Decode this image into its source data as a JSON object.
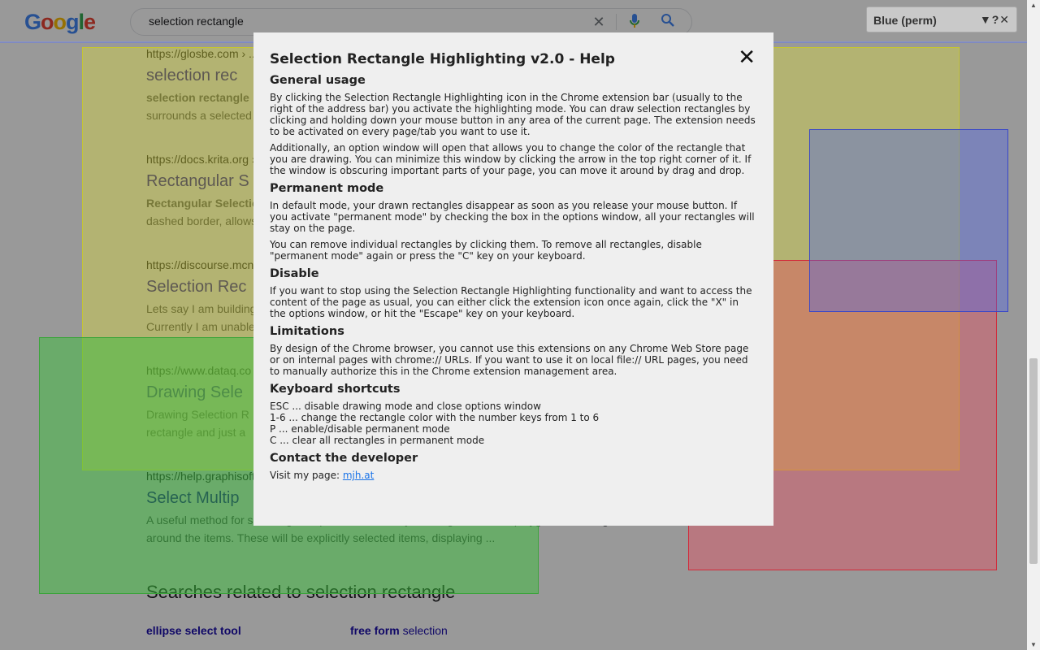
{
  "search": {
    "query": "selection rectangle",
    "logo_letters": [
      "G",
      "o",
      "o",
      "g",
      "l",
      "e"
    ]
  },
  "results": [
    {
      "cite": "https://glosbe.com › ...",
      "title": "selection rec",
      "snippet_bold": "selection rectangle",
      "snippet": "surrounds a selected"
    },
    {
      "cite": "https://docs.krita.org ›",
      "title": "Rectangular S",
      "snippet_bold": "Rectangular Selectio",
      "snippet": "dashed border, allows"
    },
    {
      "cite": "https://discourse.mcn",
      "title": "Selection Rec",
      "snippet_line1": "Lets say I am building",
      "snippet_line2": "Currently I am unable"
    },
    {
      "cite": "https://www.dataq.co",
      "title": "Drawing Sele",
      "snippet_line1": "Drawing Selection R",
      "snippet_line2": "rectangle and just a"
    },
    {
      "cite": "https://help.graphisoft",
      "title": "Select Multip",
      "snippet_line1": "A useful method for selecting multiple elements is by drawing a selection polygon or rectangle",
      "snippet_line2": "around the items. These will be explicitly selected items, displaying ..."
    }
  ],
  "related": {
    "heading": "Searches related to selection rectangle",
    "items": [
      {
        "bold": "ellipse select tool",
        "normal": ""
      },
      {
        "bold": "free form",
        "normal": " selection"
      }
    ]
  },
  "options_window": {
    "label": "Blue (perm)",
    "minimize": "▼",
    "help": "?",
    "close": "✕"
  },
  "help": {
    "title": "Selection Rectangle Highlighting v2.0 - Help",
    "close": "✕",
    "sections": {
      "general": {
        "heading": "General usage",
        "p1": "By clicking the Selection Rectangle Highlighting icon in the Chrome extension bar (usually to the right of the address bar) you activate the highlighting mode. You can draw selection rectangles by clicking and holding down your mouse button in any area of the current page. The extension needs to be activated on every page/tab you want to use it.",
        "p2": "Additionally, an option window will open that allows you to change the color of the rectangle that you are drawing. You can minimize this window by clicking the arrow in the top right corner of it. If the window is obscuring important parts of your page, you can move it around by drag and drop."
      },
      "permanent": {
        "heading": "Permanent mode",
        "p1": "In default mode, your drawn rectangles disappear as soon as you release your mouse button. If you activate \"permanent mode\" by checking the box in the options window, all your rectangles will stay on the page.",
        "p2": "You can remove individual rectangles by clicking them. To remove all rectangles, disable \"permanent mode\" again or press the \"C\" key on your keyboard."
      },
      "disable": {
        "heading": "Disable",
        "p1": "If you want to stop using the Selection Rectangle Highlighting functionality and want to access the content of the page as usual, you can either click the extension icon once again, click the \"X\" in the options window, or hit the \"Escape\" key on your keyboard."
      },
      "limitations": {
        "heading": "Limitations",
        "p1": "By design of the Chrome browser, you cannot use this extensions on any Chrome Web Store page or on internal pages with chrome:// URLs. If you want to use it on local file:// URL pages, you need to manually authorize this in the Chrome extension management area."
      },
      "shortcuts": {
        "heading": "Keyboard shortcuts",
        "lines": [
          "ESC ... disable drawing mode and close options window",
          "1-6 ... change the rectangle color with the number keys from 1 to 6",
          "P ... enable/disable permanent mode",
          "C ... clear all rectangles in permanent mode"
        ]
      },
      "contact": {
        "heading": "Contact the developer",
        "prefix": "Visit my page: ",
        "link": "mjh.at"
      }
    }
  },
  "colors": {
    "link": "#1a0dab",
    "help_link": "#1a73e8",
    "yellow_rect": "#dcdc32",
    "green_rect": "#3cbe3c",
    "red_rect": "#e6465a",
    "blue_rect": "#5064e6"
  }
}
